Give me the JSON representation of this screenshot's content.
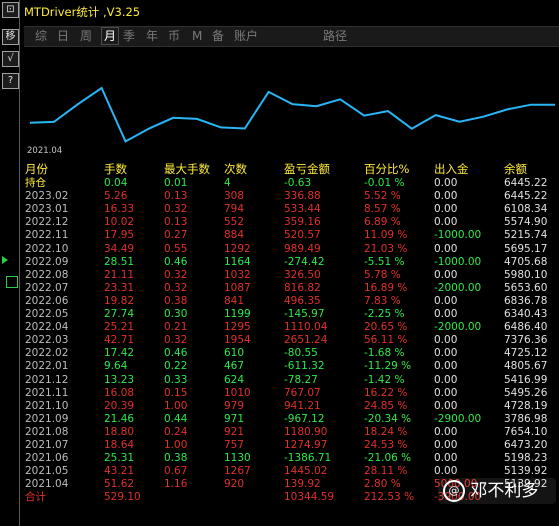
{
  "app": {
    "title": "MTDriver统计 ,V3.25"
  },
  "side_buttons": [
    {
      "label": "⊡",
      "icon": "window-icon"
    },
    {
      "label": "移",
      "icon": "move-icon"
    },
    {
      "label": "√",
      "icon": "check-icon"
    },
    {
      "label": "?",
      "icon": "help-icon"
    }
  ],
  "tabs": [
    "综",
    "日",
    "周",
    "月",
    "季",
    "年",
    "币",
    "M",
    "备",
    "账户",
    "路径"
  ],
  "active_tab": "月",
  "chart_data": {
    "type": "line",
    "x": [
      "2021.04",
      "2021.05",
      "2021.06",
      "2021.07",
      "2021.08",
      "2021.09",
      "2021.10",
      "2021.11",
      "2021.12",
      "2022.01",
      "2022.02",
      "2022.03",
      "2022.04",
      "2022.05",
      "2022.06",
      "2022.07",
      "2022.08",
      "2022.09",
      "2022.10",
      "2022.11",
      "2022.12",
      "2023.01",
      "2023.02"
    ],
    "series": [
      {
        "values": [
          5139.92,
          5198.23,
          6473.2,
          7654.1,
          3786.98,
          4728.19,
          5495.26,
          5416.99,
          4805.67,
          4725.12,
          7376.36,
          6486.4,
          6340.43,
          6836.78,
          5653.6,
          5980.1,
          4705.68,
          5695.17,
          5215.74,
          5574.9,
          6108.34,
          6445.22,
          6445.22
        ]
      }
    ],
    "x_label_shown": "2021.04",
    "color": "#29b6f6"
  },
  "table": {
    "headers": [
      "月份",
      "手数",
      "最大手数",
      "次数",
      "盈亏金额",
      "百分比%",
      "出入金",
      "余额"
    ],
    "rows": [
      [
        "持仓",
        "0.04",
        "0.01",
        "4",
        "-0.63",
        "-0.01 %",
        "0.00",
        "6445.22"
      ],
      [
        "2023.02",
        "5.26",
        "0.13",
        "308",
        "336.88",
        "5.52 %",
        "0.00",
        "6445.22"
      ],
      [
        "2023.01",
        "16.33",
        "0.32",
        "794",
        "533.44",
        "8.57 %",
        "0.00",
        "6108.34"
      ],
      [
        "2022.12",
        "10.02",
        "0.13",
        "552",
        "359.16",
        "6.89 %",
        "0.00",
        "5574.90"
      ],
      [
        "2022.11",
        "17.95",
        "0.27",
        "884",
        "520.57",
        "11.09 %",
        "-1000.00",
        "5215.74"
      ],
      [
        "2022.10",
        "34.49",
        "0.55",
        "1292",
        "989.49",
        "21.03 %",
        "0.00",
        "5695.17"
      ],
      [
        "2022.09",
        "28.51",
        "0.46",
        "1164",
        "-274.42",
        "-5.51 %",
        "-1000.00",
        "4705.68"
      ],
      [
        "2022.08",
        "21.11",
        "0.32",
        "1032",
        "326.50",
        "5.78 %",
        "0.00",
        "5980.10"
      ],
      [
        "2022.07",
        "23.31",
        "0.32",
        "1087",
        "816.82",
        "16.89 %",
        "-2000.00",
        "5653.60"
      ],
      [
        "2022.06",
        "19.82",
        "0.38",
        "841",
        "496.35",
        "7.83 %",
        "0.00",
        "6836.78"
      ],
      [
        "2022.05",
        "27.74",
        "0.30",
        "1199",
        "-145.97",
        "-2.25 %",
        "0.00",
        "6340.43"
      ],
      [
        "2022.04",
        "25.21",
        "0.21",
        "1295",
        "1110.04",
        "20.65 %",
        "-2000.00",
        "6486.40"
      ],
      [
        "2022.03",
        "42.71",
        "0.32",
        "1954",
        "2651.24",
        "56.11 %",
        "0.00",
        "7376.36"
      ],
      [
        "2022.02",
        "17.42",
        "0.46",
        "610",
        "-80.55",
        "-1.68 %",
        "0.00",
        "4725.12"
      ],
      [
        "2022.01",
        "9.64",
        "0.22",
        "467",
        "-611.32",
        "-11.29 %",
        "0.00",
        "4805.67"
      ],
      [
        "2021.12",
        "13.23",
        "0.33",
        "624",
        "-78.27",
        "-1.42 %",
        "0.00",
        "5416.99"
      ],
      [
        "2021.11",
        "16.08",
        "0.15",
        "1010",
        "767.07",
        "16.22 %",
        "0.00",
        "5495.26"
      ],
      [
        "2021.10",
        "20.39",
        "1.00",
        "979",
        "941.21",
        "24.85 %",
        "0.00",
        "4728.19"
      ],
      [
        "2021.09",
        "21.46",
        "0.44",
        "971",
        "-967.12",
        "-20.34 %",
        "-2900.00",
        "3786.98"
      ],
      [
        "2021.08",
        "18.80",
        "0.24",
        "921",
        "1180.90",
        "18.24 %",
        "0.00",
        "7654.10"
      ],
      [
        "2021.07",
        "18.64",
        "1.00",
        "757",
        "1274.97",
        "24.53 %",
        "0.00",
        "6473.20"
      ],
      [
        "2021.06",
        "25.31",
        "0.38",
        "1130",
        "-1386.71",
        "-21.06 %",
        "0.00",
        "5198.23"
      ],
      [
        "2021.05",
        "43.21",
        "0.67",
        "1267",
        "1445.02",
        "28.11 %",
        "0.00",
        "5139.92"
      ],
      [
        "2021.04",
        "51.62",
        "1.16",
        "920",
        "139.92",
        "2.80 %",
        "5000.00",
        "5139.92"
      ],
      [
        "合计",
        "529.10",
        "",
        "",
        "10344.59",
        "212.53 %",
        "-3900.00",
        ""
      ]
    ]
  },
  "watermark": {
    "text": "邓不利多",
    "icon": "weibo-icon"
  }
}
